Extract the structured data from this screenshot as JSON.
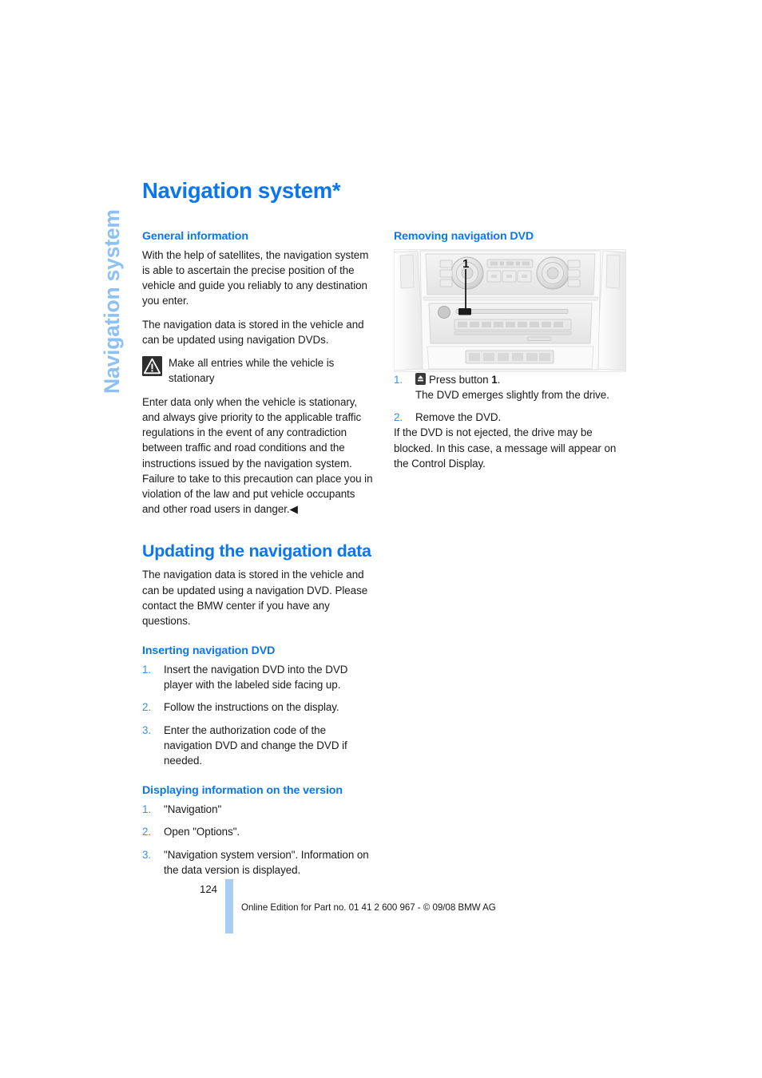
{
  "document": {
    "side_tab_label": "Navigation system",
    "page_title": "Navigation system*",
    "page_number": "124",
    "footer_text": "Online Edition for Part no. 01 41 2 600 967  - © 09/08 BMW AG"
  },
  "colors": {
    "heading_blue": "#0a76f0",
    "side_tab_blue": "#8dc0f5",
    "list_number_blue": "#3a8ff2",
    "footer_bar_blue": "#a9cef3",
    "body_text": "#1a1a1a"
  },
  "left_column": {
    "general_information": {
      "heading": "General information",
      "paragraph_1": "With the help of satellites, the navigation system is able to ascertain the precise position of the vehicle and guide you reliably to any destination you enter.",
      "paragraph_2": "The navigation data is stored in the vehicle and can be updated using navigation DVDs.",
      "warning_icon": "warning-triangle-icon",
      "warning_text": "Make all entries while the vehicle is stationary",
      "paragraph_3": "Enter data only when the vehicle is stationary, and always give priority to the applicable traffic regulations in the event of any contradiction between traffic and road conditions and the instructions issued by the navigation system. Failure to take to this precaution can place you in violation of the law and put vehicle occupants and other road users in danger.◀"
    },
    "updating": {
      "heading": "Updating the navigation data",
      "paragraph_1": "The navigation data is stored in the vehicle and can be updated using a navigation DVD. Please contact the BMW center if you have any questions."
    },
    "inserting": {
      "heading": "Inserting navigation DVD",
      "steps": [
        "Insert the navigation DVD into the DVD player with the labeled side facing up.",
        "Follow the instructions on the display.",
        "Enter the authorization code of the navigation DVD and change the DVD if needed."
      ]
    },
    "version_info": {
      "heading": "Displaying information on the version",
      "steps": [
        "\"Navigation\"",
        "Open \"Options\".",
        "\"Navigation system version\". Information on the data version is displayed."
      ]
    }
  },
  "right_column": {
    "removing": {
      "heading": "Removing navigation DVD",
      "figure": {
        "name": "center-console-illustration",
        "callout_label": "1",
        "description": "Vehicle center console showing climate control knobs, radio/DVD unit and eject button"
      },
      "step_1_icon": "eject-button-icon",
      "step_1_prefix": "Press button ",
      "step_1_bold": "1",
      "step_1_suffix": ".",
      "step_1_detail": "The DVD emerges slightly from the drive.",
      "step_2": "Remove the DVD.",
      "paragraph_after": "If the DVD is not ejected, the drive may be blocked. In this case, a message will appear on the Control Display."
    }
  }
}
